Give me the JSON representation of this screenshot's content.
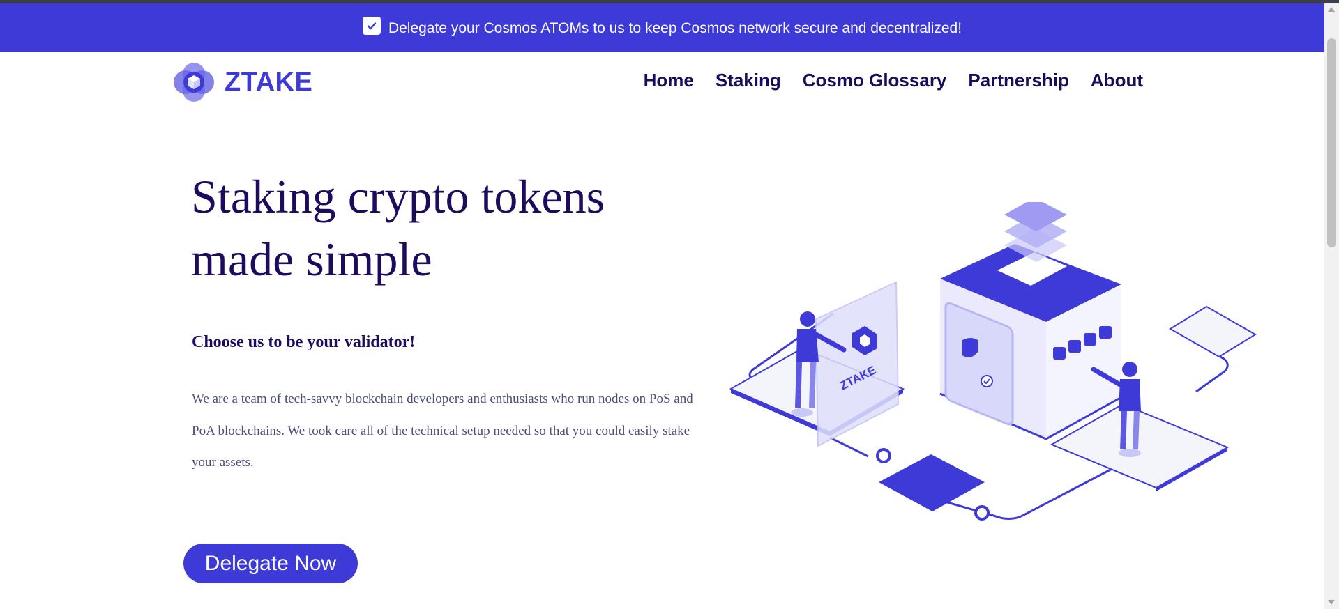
{
  "banner": {
    "text": "Delegate your Cosmos ATOMs to us to keep Cosmos network secure and decentralized!",
    "icon": "check-icon",
    "color": "#3e3ad8"
  },
  "brand": {
    "name": "ZTAKE",
    "color": "#3e3ad8"
  },
  "nav": {
    "items": [
      {
        "label": "Home"
      },
      {
        "label": "Staking"
      },
      {
        "label": "Cosmo Glossary"
      },
      {
        "label": "Partnership"
      },
      {
        "label": "About"
      }
    ]
  },
  "hero": {
    "title": "Staking crypto tokens made simple",
    "subtitle": "Choose us to be your validator!",
    "description": "We are a team of tech-savvy blockchain developers and enthusiasts who run nodes on PoS and PoA blockchains. We took care all of the technical setup needed so that you could easily stake your assets.",
    "cta_label": "Delegate Now",
    "illustration_label": "ZTAKE"
  }
}
